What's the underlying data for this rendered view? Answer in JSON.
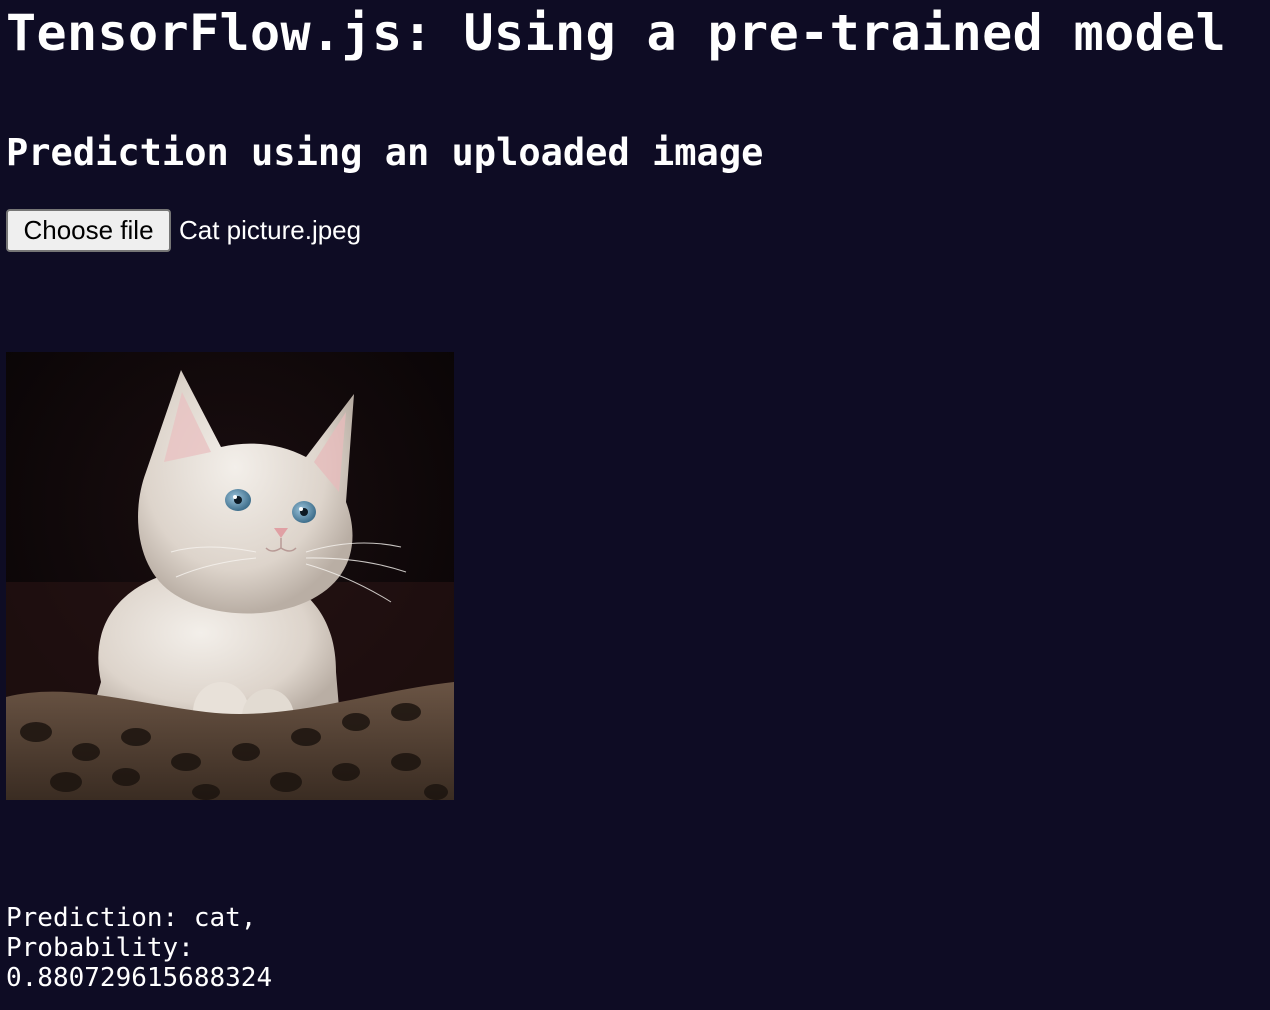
{
  "page": {
    "title": "TensorFlow.js: Using a pre-trained model",
    "background": "#0e0c24",
    "text_color": "#ffffff"
  },
  "upload": {
    "heading": "Prediction using an uploaded image",
    "button_label": "Choose file",
    "file_name": "Cat picture.jpeg"
  },
  "preview": {
    "subject": "white-kitten-photo"
  },
  "result": {
    "prediction_line": "Prediction: cat,",
    "probability_label": "Probability:",
    "probability_value": "0.880729615688324"
  }
}
